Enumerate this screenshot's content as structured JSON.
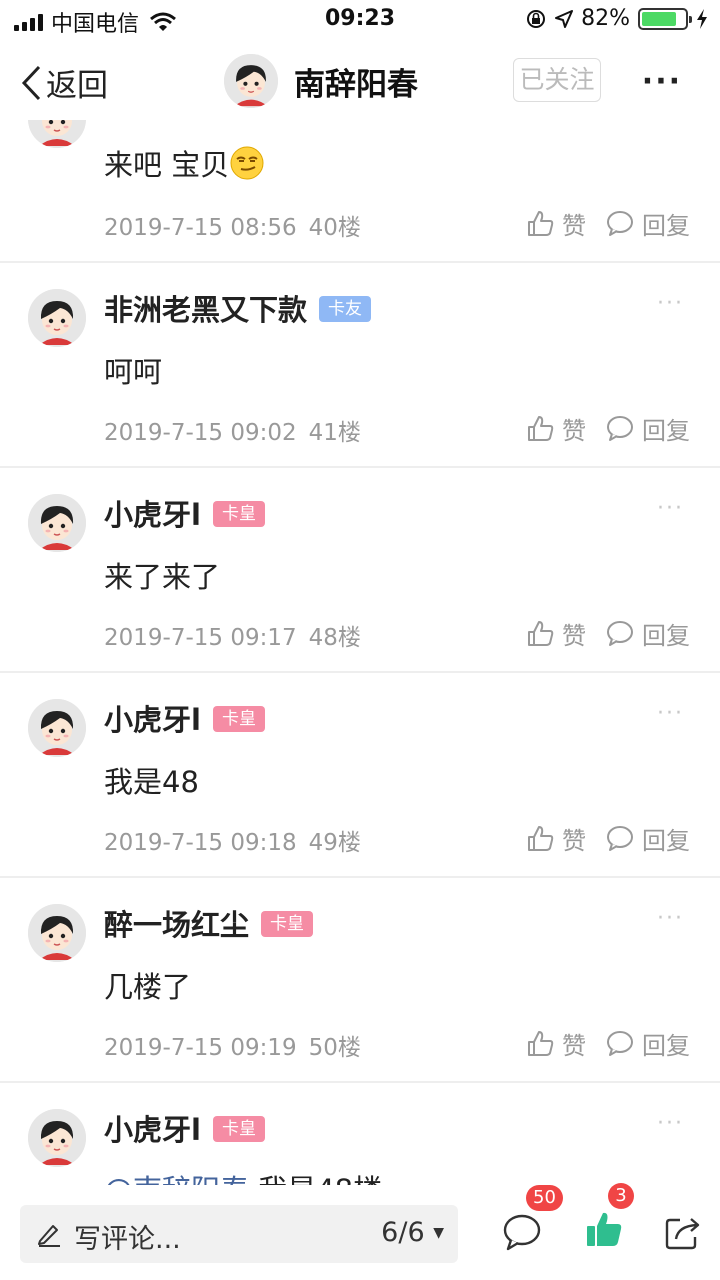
{
  "status_bar": {
    "carrier": "中国电信",
    "time": "09:23",
    "battery": "82%",
    "battery_level": 0.82
  },
  "nav": {
    "back_label": "返回",
    "title": "南辞阳春",
    "follow_label": "已关注",
    "more_label": "···"
  },
  "comments": [
    {
      "text": "来吧 宝贝",
      "time": "2019-7-15 08:56",
      "floor": "40楼",
      "like_label": "赞",
      "reply_label": "回复"
    },
    {
      "user": "非洲老黑又下款",
      "badge": "卡友",
      "text": "呵呵",
      "time": "2019-7-15 09:02",
      "floor": "41楼",
      "like_label": "赞",
      "reply_label": "回复"
    },
    {
      "user": "小虎牙l",
      "badge": "卡皇",
      "text": "来了来了",
      "time": "2019-7-15 09:17",
      "floor": "48楼",
      "like_label": "赞",
      "reply_label": "回复"
    },
    {
      "user": "小虎牙l",
      "badge": "卡皇",
      "text": "我是48",
      "time": "2019-7-15 09:18",
      "floor": "49楼",
      "like_label": "赞",
      "reply_label": "回复"
    },
    {
      "user": "醉一场红尘",
      "badge": "卡皇",
      "text": "几楼了",
      "time": "2019-7-15 09:19",
      "floor": "50楼",
      "like_label": "赞",
      "reply_label": "回复"
    },
    {
      "user": "小虎牙l",
      "badge": "卡皇",
      "mention": "@南辞阳春",
      "text": "我是48楼"
    }
  ],
  "bottom_bar": {
    "placeholder": "写评论...",
    "page": "6/6",
    "comment_count": "50",
    "like_count": "3"
  },
  "colors": {
    "badge_friend": "#8fb8f5",
    "badge_king": "#f58ca4",
    "like_active": "#2fbe8f",
    "count_badge": "#f04545",
    "mention": "#44649c"
  }
}
